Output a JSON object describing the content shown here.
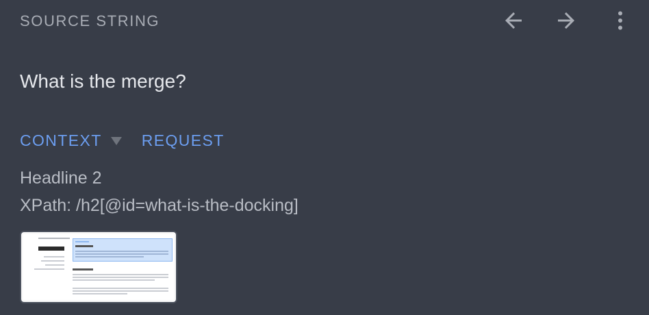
{
  "header": {
    "title": "SOURCE STRING",
    "back_icon": "arrow-left-icon",
    "forward_icon": "arrow-right-icon",
    "more_icon": "more-vert-icon"
  },
  "source": {
    "text": "What is the merge?"
  },
  "tabs": [
    {
      "label": "CONTEXT",
      "has_caret": true
    },
    {
      "label": "REQUEST"
    }
  ],
  "context": {
    "element_type": "Headline 2",
    "xpath": "XPath: /h2[@id=what-is-the-docking]"
  },
  "screenshot": {
    "heading": "The merge",
    "highlight": "What is the merge?"
  },
  "colors": {
    "background": "#383d48",
    "accent": "#6c9ef0",
    "text_primary": "#e6e8ec",
    "text_secondary": "#b9bdc5"
  }
}
